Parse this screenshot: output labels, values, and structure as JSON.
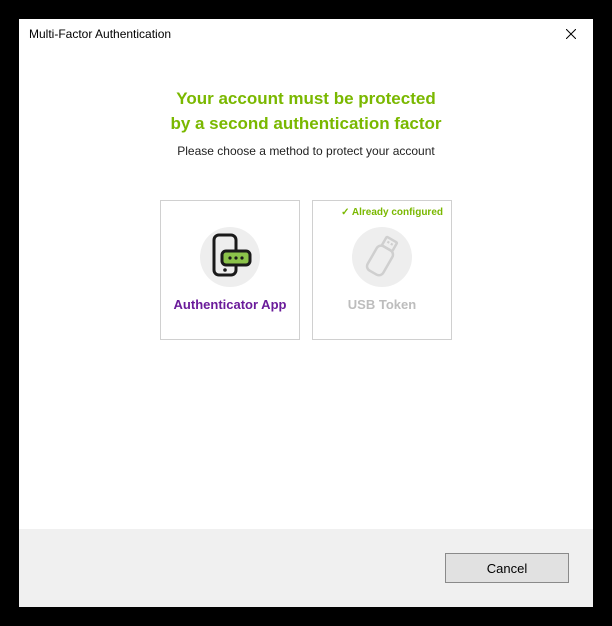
{
  "window": {
    "title": "Multi-Factor Authentication"
  },
  "heading": {
    "line1": "Your account must be protected",
    "line2": "by a second authentication factor"
  },
  "subtext": "Please choose a method to protect your account",
  "options": {
    "authenticator": {
      "label": "Authenticator App"
    },
    "usb": {
      "label": "USB Token",
      "status": "✓ Already configured"
    }
  },
  "footer": {
    "cancel": "Cancel"
  }
}
